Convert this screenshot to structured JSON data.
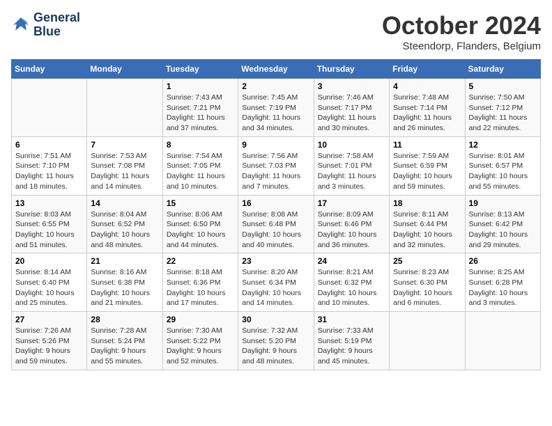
{
  "header": {
    "logo_line1": "General",
    "logo_line2": "Blue",
    "month": "October 2024",
    "location": "Steendorp, Flanders, Belgium"
  },
  "weekdays": [
    "Sunday",
    "Monday",
    "Tuesday",
    "Wednesday",
    "Thursday",
    "Friday",
    "Saturday"
  ],
  "weeks": [
    [
      {
        "day": "",
        "info": ""
      },
      {
        "day": "",
        "info": ""
      },
      {
        "day": "1",
        "info": "Sunrise: 7:43 AM\nSunset: 7:21 PM\nDaylight: 11 hours and 37 minutes."
      },
      {
        "day": "2",
        "info": "Sunrise: 7:45 AM\nSunset: 7:19 PM\nDaylight: 11 hours and 34 minutes."
      },
      {
        "day": "3",
        "info": "Sunrise: 7:46 AM\nSunset: 7:17 PM\nDaylight: 11 hours and 30 minutes."
      },
      {
        "day": "4",
        "info": "Sunrise: 7:48 AM\nSunset: 7:14 PM\nDaylight: 11 hours and 26 minutes."
      },
      {
        "day": "5",
        "info": "Sunrise: 7:50 AM\nSunset: 7:12 PM\nDaylight: 11 hours and 22 minutes."
      }
    ],
    [
      {
        "day": "6",
        "info": "Sunrise: 7:51 AM\nSunset: 7:10 PM\nDaylight: 11 hours and 18 minutes."
      },
      {
        "day": "7",
        "info": "Sunrise: 7:53 AM\nSunset: 7:08 PM\nDaylight: 11 hours and 14 minutes."
      },
      {
        "day": "8",
        "info": "Sunrise: 7:54 AM\nSunset: 7:05 PM\nDaylight: 11 hours and 10 minutes."
      },
      {
        "day": "9",
        "info": "Sunrise: 7:56 AM\nSunset: 7:03 PM\nDaylight: 11 hours and 7 minutes."
      },
      {
        "day": "10",
        "info": "Sunrise: 7:58 AM\nSunset: 7:01 PM\nDaylight: 11 hours and 3 minutes."
      },
      {
        "day": "11",
        "info": "Sunrise: 7:59 AM\nSunset: 6:59 PM\nDaylight: 10 hours and 59 minutes."
      },
      {
        "day": "12",
        "info": "Sunrise: 8:01 AM\nSunset: 6:57 PM\nDaylight: 10 hours and 55 minutes."
      }
    ],
    [
      {
        "day": "13",
        "info": "Sunrise: 8:03 AM\nSunset: 6:55 PM\nDaylight: 10 hours and 51 minutes."
      },
      {
        "day": "14",
        "info": "Sunrise: 8:04 AM\nSunset: 6:52 PM\nDaylight: 10 hours and 48 minutes."
      },
      {
        "day": "15",
        "info": "Sunrise: 8:06 AM\nSunset: 6:50 PM\nDaylight: 10 hours and 44 minutes."
      },
      {
        "day": "16",
        "info": "Sunrise: 8:08 AM\nSunset: 6:48 PM\nDaylight: 10 hours and 40 minutes."
      },
      {
        "day": "17",
        "info": "Sunrise: 8:09 AM\nSunset: 6:46 PM\nDaylight: 10 hours and 36 minutes."
      },
      {
        "day": "18",
        "info": "Sunrise: 8:11 AM\nSunset: 6:44 PM\nDaylight: 10 hours and 32 minutes."
      },
      {
        "day": "19",
        "info": "Sunrise: 8:13 AM\nSunset: 6:42 PM\nDaylight: 10 hours and 29 minutes."
      }
    ],
    [
      {
        "day": "20",
        "info": "Sunrise: 8:14 AM\nSunset: 6:40 PM\nDaylight: 10 hours and 25 minutes."
      },
      {
        "day": "21",
        "info": "Sunrise: 8:16 AM\nSunset: 6:38 PM\nDaylight: 10 hours and 21 minutes."
      },
      {
        "day": "22",
        "info": "Sunrise: 8:18 AM\nSunset: 6:36 PM\nDaylight: 10 hours and 17 minutes."
      },
      {
        "day": "23",
        "info": "Sunrise: 8:20 AM\nSunset: 6:34 PM\nDaylight: 10 hours and 14 minutes."
      },
      {
        "day": "24",
        "info": "Sunrise: 8:21 AM\nSunset: 6:32 PM\nDaylight: 10 hours and 10 minutes."
      },
      {
        "day": "25",
        "info": "Sunrise: 8:23 AM\nSunset: 6:30 PM\nDaylight: 10 hours and 6 minutes."
      },
      {
        "day": "26",
        "info": "Sunrise: 8:25 AM\nSunset: 6:28 PM\nDaylight: 10 hours and 3 minutes."
      }
    ],
    [
      {
        "day": "27",
        "info": "Sunrise: 7:26 AM\nSunset: 5:26 PM\nDaylight: 9 hours and 59 minutes."
      },
      {
        "day": "28",
        "info": "Sunrise: 7:28 AM\nSunset: 5:24 PM\nDaylight: 9 hours and 55 minutes."
      },
      {
        "day": "29",
        "info": "Sunrise: 7:30 AM\nSunset: 5:22 PM\nDaylight: 9 hours and 52 minutes."
      },
      {
        "day": "30",
        "info": "Sunrise: 7:32 AM\nSunset: 5:20 PM\nDaylight: 9 hours and 48 minutes."
      },
      {
        "day": "31",
        "info": "Sunrise: 7:33 AM\nSunset: 5:19 PM\nDaylight: 9 hours and 45 minutes."
      },
      {
        "day": "",
        "info": ""
      },
      {
        "day": "",
        "info": ""
      }
    ]
  ]
}
